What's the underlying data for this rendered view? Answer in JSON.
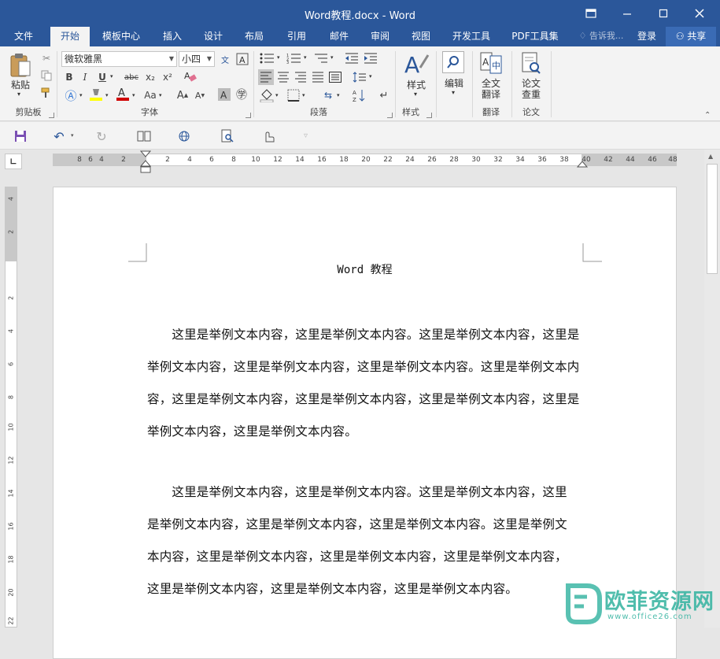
{
  "window": {
    "title": "Word教程.docx - Word"
  },
  "tabs": [
    "文件",
    "开始",
    "模板中心",
    "插入",
    "设计",
    "布局",
    "引用",
    "邮件",
    "审阅",
    "视图",
    "开发工具",
    "PDF工具集"
  ],
  "active_tab": "开始",
  "tell_me": "告诉我...",
  "signin": "登录",
  "share": "共享",
  "ribbon": {
    "clipboard": {
      "paste": "粘贴",
      "label": "剪贴板"
    },
    "font": {
      "font_name": "微软雅黑",
      "font_size": "小四",
      "label": "字体",
      "bold": "B",
      "italic": "I",
      "underline": "U",
      "strike": "abc",
      "subscript": "x₂",
      "superscript": "x²",
      "case": "Aa",
      "grow": "A",
      "shrink": "A"
    },
    "paragraph": {
      "label": "段落"
    },
    "styles": {
      "button": "样式",
      "label": "样式"
    },
    "editing": {
      "button": "编辑"
    },
    "translate": {
      "button_line1": "全文",
      "button_line2": "翻译",
      "label": "翻译"
    },
    "paper": {
      "button_line1": "论文",
      "button_line2": "查重",
      "label": "论文"
    }
  },
  "ruler": {
    "left_ticks": [
      "8",
      "6",
      "4",
      "2"
    ],
    "right_ticks": [
      "2",
      "4",
      "6",
      "8",
      "10",
      "12",
      "14",
      "16",
      "18",
      "20",
      "22",
      "24",
      "26",
      "28",
      "30",
      "32",
      "34",
      "36",
      "38",
      "40",
      "42",
      "44",
      "46",
      "48"
    ],
    "vertical_ticks": [
      "4",
      "2",
      "2",
      "4",
      "6",
      "8",
      "10",
      "12",
      "14",
      "16",
      "18",
      "20",
      "22"
    ]
  },
  "document": {
    "header": "Word 教程",
    "paragraph1": [
      "　　这里是举例文本内容，这里是举例文本内容。这里是举例文本内容，这里是",
      "举例文本内容，这里是举例文本内容，这里是举例文本内容。这里是举例文本内",
      "容，这里是举例文本内容，这里是举例文本内容，这里是举例文本内容，这里是",
      "举例文本内容，这里是举例文本内容。"
    ],
    "paragraph2": [
      "　　这里是举例文本内容，这里是举例文本内容。这里是举例文本内容，这里",
      "是举例文本内容，这里是举例文本内容，这里是举例文本内容。这里是举例文",
      "本内容，这里是举例文本内容，这里是举例文本内容，这里是举例文本内容，",
      "这里是举例文本内容，这里是举例文本内容，这里是举例文本内容。"
    ]
  },
  "watermark": {
    "brand": "欧菲资源网",
    "url": "www.office26.com"
  },
  "colors": {
    "accent": "#2b579a",
    "font_color_bar": "#d00000",
    "highlight_bar": "#ffff00",
    "watermark": "#3cb6a4"
  }
}
